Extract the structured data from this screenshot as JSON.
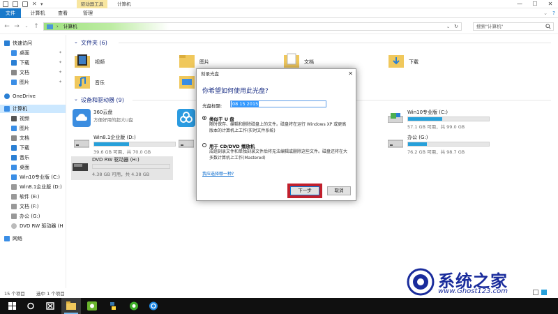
{
  "titlebar": {
    "contextual_tab": "驱动器工具",
    "window_title": "计算机",
    "controls": [
      "—",
      "☐",
      "✕"
    ]
  },
  "ribbon": {
    "tabs": [
      "文件",
      "计算机",
      "查看",
      "管理"
    ]
  },
  "address": {
    "path": "计算机",
    "search_placeholder": "搜索\"计算机\""
  },
  "sidebar": {
    "items": [
      {
        "label": "快速访问",
        "icon": "star-icon",
        "color": "#2a7fd4"
      },
      {
        "label": "桌面",
        "icon": "desktop-icon",
        "color": "#3a8ee6"
      },
      {
        "label": "下载",
        "icon": "download-icon",
        "color": "#2a7fd4"
      },
      {
        "label": "文档",
        "icon": "document-icon",
        "color": "#888888"
      },
      {
        "label": "图片",
        "icon": "picture-icon",
        "color": "#3a8ee6"
      },
      {
        "label": "OneDrive",
        "icon": "cloud-icon",
        "color": "#2a7fd4"
      },
      {
        "label": "计算机",
        "icon": "computer-icon",
        "color": "#3a8ee6"
      },
      {
        "label": "视频",
        "icon": "video-icon",
        "color": "#555555"
      },
      {
        "label": "图片",
        "icon": "picture-icon",
        "color": "#3a8ee6"
      },
      {
        "label": "文档",
        "icon": "document-icon",
        "color": "#888888"
      },
      {
        "label": "下载",
        "icon": "download-icon",
        "color": "#2a7fd4"
      },
      {
        "label": "音乐",
        "icon": "music-icon",
        "color": "#2a7fd4"
      },
      {
        "label": "桌面",
        "icon": "desktop-icon",
        "color": "#3a8ee6"
      },
      {
        "label": "Win10专业版 (C:)",
        "icon": "drive-icon",
        "color": "#3a8ee6"
      },
      {
        "label": "Win8.1企业版 (D:)",
        "icon": "drive-icon",
        "color": "#999999"
      },
      {
        "label": "软件 (E:)",
        "icon": "drive-icon",
        "color": "#999999"
      },
      {
        "label": "文档 (F:)",
        "icon": "drive-icon",
        "color": "#999999"
      },
      {
        "label": "办公 (G:)",
        "icon": "drive-icon",
        "color": "#999999"
      },
      {
        "label": "DVD RW 驱动器 (H",
        "icon": "dvd-icon",
        "color": "#bbbbbb"
      },
      {
        "label": "网络",
        "icon": "network-icon",
        "color": "#3a8ee6"
      }
    ]
  },
  "main": {
    "folders_header": "文件夹 (6)",
    "folders": [
      {
        "label": "视频",
        "icon": "video-folder-icon"
      },
      {
        "label": "图片",
        "icon": "picture-folder-icon"
      },
      {
        "label": "文档",
        "icon": "document-folder-icon"
      },
      {
        "label": "下载",
        "icon": "download-folder-icon"
      },
      {
        "label": "音乐",
        "icon": "music-folder-icon"
      },
      {
        "label": "",
        "icon": "desktop-folder-icon"
      }
    ],
    "drives_header": "设备和驱动器 (9)",
    "drives": [
      {
        "name": "360云盘",
        "free": "方便好用的超大U盘",
        "fill": null
      },
      {
        "name": "",
        "free": "",
        "fill": null
      },
      {
        "name": "Win10专业版 (C:)",
        "free": "57.1 GB 可用，共 99.0 GB",
        "fill": 0.42
      },
      {
        "name": "Win8.1企业版 (D:)",
        "free": "39.6 GB 可用，共 70.0 GB",
        "fill": 0.43
      },
      {
        "name": "",
        "free": "",
        "fill": null
      },
      {
        "name": "办公 (G:)",
        "free": "76.2 GB 可用，共 98.7 GB",
        "fill": 0.23
      },
      {
        "name": "DVD RW 驱动器 (H:)",
        "free": "4.38 GB 可用，共 4.38 GB",
        "fill": 0.0
      }
    ]
  },
  "dialog": {
    "title": "刻录光盘",
    "close": "✕",
    "question": "你希望如何使用此光盘?",
    "disc_title_label": "光盘标题:",
    "disc_title_value": "08 15 2015",
    "opt1_title": "类似于 U 盘",
    "opt1_desc": "随时保存、编辑和删除磁盘上的文件。磁盘将在运行 Windows XP 或更高版本的计算机上工作(实时文件系统)",
    "opt2_title": "用于 CD/DVD 播放机",
    "opt2_desc": "成组刻录文件和单独刻录文件后将无法编辑或删除这些文件。磁盘还将在大多数计算机上工作(Mastered)",
    "help_link": "我应选择哪一种?",
    "next": "下一步",
    "cancel": "取消"
  },
  "status": {
    "count": "15 个项目",
    "selected": "选中 1 个项目"
  },
  "watermark": {
    "text": "系统之家",
    "url": "www.Ghost123.com"
  },
  "colors": {
    "accent": "#1979ca",
    "highlight": "#c1202d",
    "drive_bar": "#26a0da"
  }
}
